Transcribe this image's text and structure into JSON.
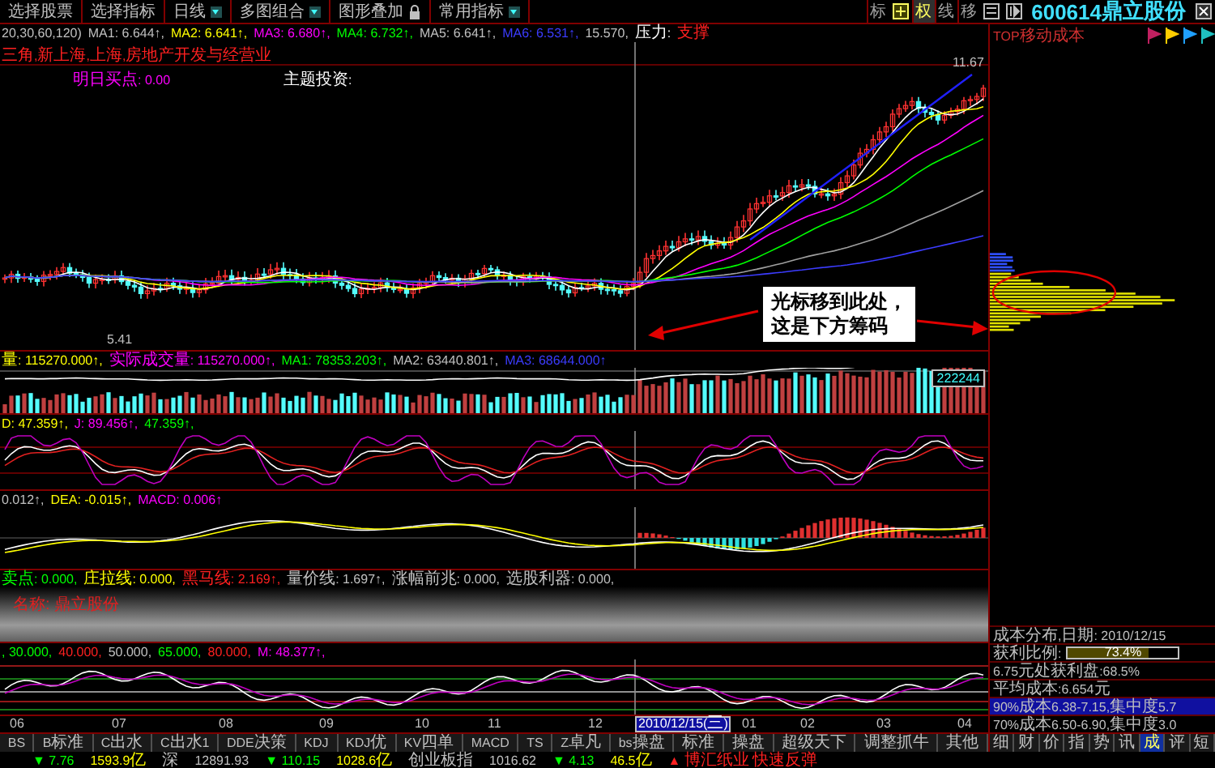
{
  "toolbar": {
    "menus": [
      {
        "label": "选择股票",
        "dropdown": false,
        "locked": false
      },
      {
        "label": "选择指标",
        "dropdown": false,
        "locked": false
      },
      {
        "label": "日线",
        "dropdown": true,
        "locked": false
      },
      {
        "label": "多图组合",
        "dropdown": true,
        "locked": false
      },
      {
        "label": "图形叠加",
        "dropdown": false,
        "locked": true
      },
      {
        "label": "常用指标",
        "dropdown": true,
        "locked": false
      }
    ],
    "tools": [
      {
        "label": "标",
        "selected": false
      },
      {
        "label": "权",
        "selected": true
      },
      {
        "label": "线",
        "selected": false
      },
      {
        "label": "移",
        "selected": false
      }
    ],
    "stock": {
      "code": "600614",
      "name": "鼎立股份"
    }
  },
  "ma_row": [
    {
      "text": "20,30,60,120)",
      "color": "#c0c0c0"
    },
    {
      "text": "MA1: 6.644↑,",
      "color": "#c0c0c0"
    },
    {
      "text": "MA2: 6.641↑,",
      "color": "#ffff00"
    },
    {
      "text": "MA3: 6.680↑,",
      "color": "#ff00ff"
    },
    {
      "text": "MA4: 6.732↑,",
      "color": "#00ff00"
    },
    {
      "text": "MA5: 6.641↑,",
      "color": "#c0c0c0"
    },
    {
      "text": "MA6: 6.531↑,",
      "color": "#3c3cff"
    },
    {
      "text": "15.570,",
      "color": "#c0c0c0"
    },
    {
      "text": "压力:",
      "color": "#ffffff"
    },
    {
      "text": "支撑",
      "color": "#ff2020"
    }
  ],
  "main_chart": {
    "industry": {
      "text": "三角,新上海,上海,房地产开发与经营业",
      "color": "#ff2020"
    },
    "buy_point": {
      "text": "明日买点: 0.00",
      "color": "#ff00ff"
    },
    "theme": {
      "text": "主题投资:",
      "color": "#ffffff"
    },
    "high_label": "11.67",
    "low_label": "5.41",
    "callout": [
      "光标移到此处，",
      "这是下方筹码"
    ]
  },
  "volume_row": [
    {
      "text": "量: 115270.000↑,",
      "color": "#ffff00"
    },
    {
      "text": "实际成交量: 115270.000↑,",
      "color": "#ff00ff"
    },
    {
      "text": "MA1: 78353.203↑,",
      "color": "#00ff00"
    },
    {
      "text": "MA2: 63440.801↑,",
      "color": "#c0c0c0"
    },
    {
      "text": "MA3: 68644.000↑",
      "color": "#3c3cff"
    }
  ],
  "volume_badge": "222244",
  "kdj_row": [
    {
      "text": "D: 47.359↑,",
      "color": "#ffff00"
    },
    {
      "text": "J: 89.456↑,",
      "color": "#ff00ff"
    },
    {
      "text": "47.359↑,",
      "color": "#00ff00"
    }
  ],
  "macd_row": [
    {
      "text": "0.012↑,",
      "color": "#c0c0c0"
    },
    {
      "text": "DEA: -0.015↑,",
      "color": "#ffff00"
    },
    {
      "text": "MACD: 0.006↑",
      "color": "#ff00ff"
    }
  ],
  "signal_row": [
    {
      "text": "卖点: 0.000,",
      "color": "#00ff00"
    },
    {
      "text": "庄拉线: 0.000,",
      "color": "#ffff00"
    },
    {
      "text": "黑马线: 2.169↑,",
      "color": "#ff2020"
    },
    {
      "text": "量价线: 1.697↑,",
      "color": "#c0c0c0"
    },
    {
      "text": "涨幅前兆: 0.000,",
      "color": "#c0c0c0"
    },
    {
      "text": "选股利器: 0.000,",
      "color": "#c0c0c0"
    }
  ],
  "name_panel": {
    "text": "名称: 鼎立股份"
  },
  "oscillator_row": [
    {
      "text": ", 30.000,",
      "color": "#00ff00"
    },
    {
      "text": "40.000,",
      "color": "#ff2020"
    },
    {
      "text": "50.000,",
      "color": "#c0c0c0"
    },
    {
      "text": "65.000,",
      "color": "#00ff00"
    },
    {
      "text": "80.000,",
      "color": "#ff2020"
    },
    {
      "text": "M: 48.377↑,",
      "color": "#ff00ff"
    }
  ],
  "date_axis": [
    {
      "label": "06",
      "selected": false
    },
    {
      "label": "07",
      "selected": false
    },
    {
      "label": "08",
      "selected": false
    },
    {
      "label": "09",
      "selected": false
    },
    {
      "label": "10",
      "selected": false
    },
    {
      "label": "11",
      "selected": false
    },
    {
      "label": "12",
      "selected": false
    },
    {
      "label": "2010/12/15(三)",
      "selected": true
    },
    {
      "label": "01",
      "selected": false
    },
    {
      "label": "02",
      "selected": false
    },
    {
      "label": "03",
      "selected": false
    },
    {
      "label": "04",
      "selected": false
    }
  ],
  "indicator_tabs": [
    "BS",
    "B标准",
    "C出水",
    "C出水1",
    "DDE决策",
    "KDJ",
    "KDJ优",
    "KV四单",
    "MACD",
    "TS",
    "Z卓凡",
    "bs操盘",
    "标准",
    "操盘",
    "超级天下",
    "调整抓牛",
    "其他"
  ],
  "cost_panel": {
    "title": "TOP移动成本",
    "date_line": "成本分布,日期: 2010/12/15",
    "profit": {
      "label": "获利比例:",
      "level": 0.734,
      "reading": "73.4%"
    },
    "lines": [
      "6.75元处获利盘:68.5%",
      "平均成本:6.654元"
    ],
    "ranges": [
      {
        "text": "90%成本6.38-7.15,集中度5.7",
        "selected": true
      },
      {
        "text": "70%成本6.50-6.90,集中度3.0",
        "selected": false
      }
    ],
    "tabs": [
      {
        "label": "细",
        "selected": false
      },
      {
        "label": "财",
        "selected": false
      },
      {
        "label": "价",
        "selected": false
      },
      {
        "label": "指",
        "selected": false
      },
      {
        "label": "势",
        "selected": false
      },
      {
        "label": "讯",
        "selected": false
      },
      {
        "label": "成",
        "selected": true
      },
      {
        "label": "评",
        "selected": false
      },
      {
        "label": "短",
        "selected": false
      }
    ]
  },
  "status_bar": [
    {
      "text": "▼ 7.76",
      "color": "#00ff00"
    },
    {
      "text": "1593.9亿",
      "color": "#ffff00"
    },
    {
      "text": "深",
      "color": "#c0c0c0"
    },
    {
      "text": "12891.93",
      "color": "#c0c0c0"
    },
    {
      "text": "▼ 110.15",
      "color": "#00ff00"
    },
    {
      "text": "1028.6亿",
      "color": "#ffff00"
    },
    {
      "text": "创业板指",
      "color": "#c0c0c0"
    },
    {
      "text": "1016.62",
      "color": "#c0c0c0"
    },
    {
      "text": "▼ 4.13",
      "color": "#00ff00"
    },
    {
      "text": "46.5亿",
      "color": "#ffff00"
    },
    {
      "text": "▲ 博汇纸业 快速反弹",
      "color": "#ff2020"
    }
  ]
}
